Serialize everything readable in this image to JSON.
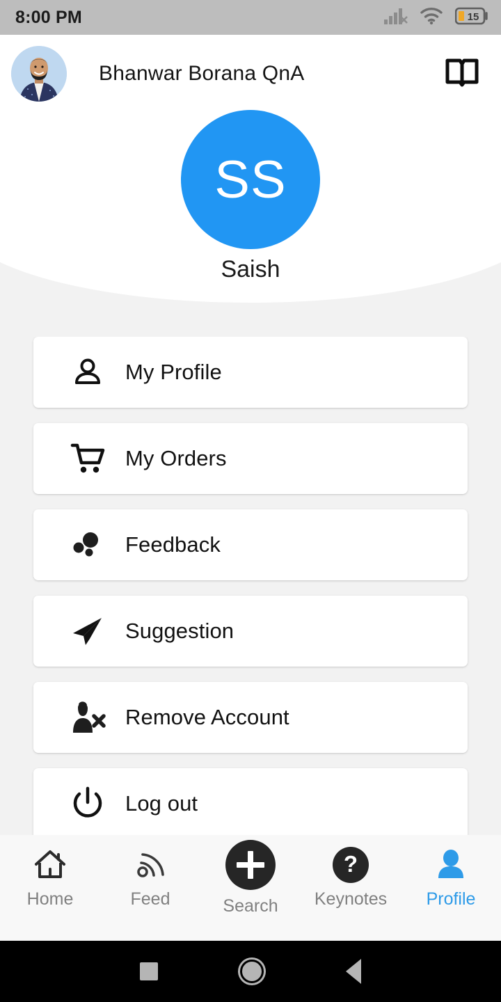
{
  "status_bar": {
    "time": "8:00 PM",
    "battery_level": "15",
    "icons": [
      "cellular-signal-icon",
      "wifi-icon",
      "battery-icon"
    ]
  },
  "header": {
    "app_title": "Bhanwar Borana QnA",
    "avatar_photo_alt": "instructor-photo",
    "book_icon": "book-icon"
  },
  "profile": {
    "initials": "SS",
    "name": "Saish",
    "avatar_color": "#2196F3"
  },
  "menu": {
    "items": [
      {
        "label": "My Profile",
        "icon": "person-outline-icon"
      },
      {
        "label": "My Orders",
        "icon": "shopping-cart-icon"
      },
      {
        "label": "Feedback",
        "icon": "bubbles-icon"
      },
      {
        "label": "Suggestion",
        "icon": "paper-plane-icon"
      },
      {
        "label": "Remove Account",
        "icon": "person-remove-icon"
      },
      {
        "label": "Log out",
        "icon": "power-icon"
      }
    ]
  },
  "bottom_nav": {
    "active": "Profile",
    "active_color": "#2E9BE8",
    "inactive_color": "#808080",
    "items": [
      {
        "label": "Home",
        "icon": "home-icon"
      },
      {
        "label": "Feed",
        "icon": "rss-feed-icon"
      },
      {
        "label": "Search",
        "icon": "plus-circle-icon"
      },
      {
        "label": "Keynotes",
        "icon": "question-circle-icon"
      },
      {
        "label": "Profile",
        "icon": "person-filled-icon"
      }
    ]
  },
  "android_nav": {
    "buttons": [
      "recents-square-icon",
      "home-circle-icon",
      "back-triangle-icon"
    ]
  }
}
